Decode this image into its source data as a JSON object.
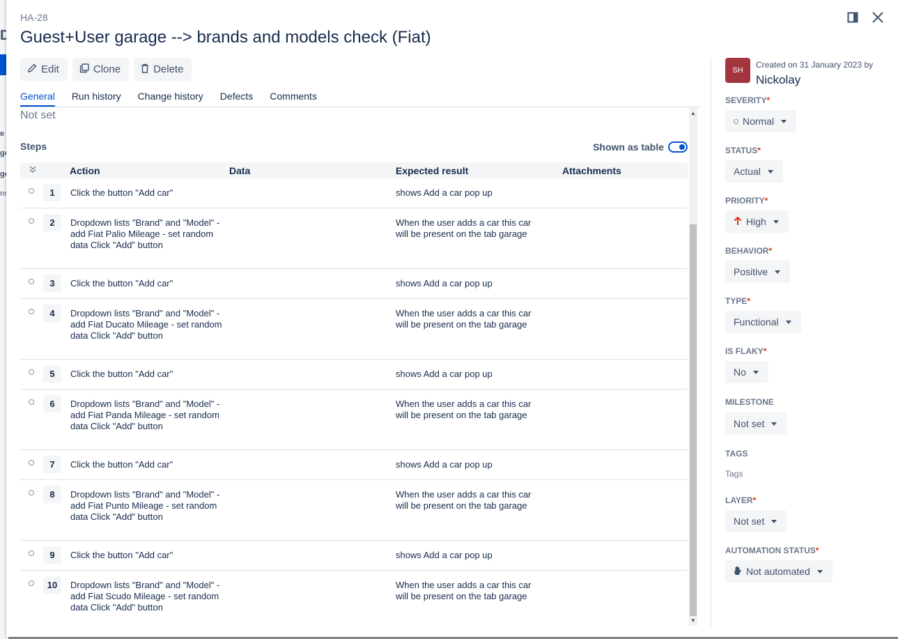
{
  "background": {
    "fragments": [
      "D",
      "e",
      "ge",
      "ge",
      "ns"
    ]
  },
  "issue": {
    "key": "HA-28",
    "title": "Guest+User garage --> brands and models check (Fiat)"
  },
  "toolbar": {
    "edit": "Edit",
    "clone": "Clone",
    "delete": "Delete"
  },
  "tabs": [
    "General",
    "Run history",
    "Change history",
    "Defects",
    "Comments"
  ],
  "general": {
    "precondition_value": "Not set",
    "steps_label": "Steps",
    "shown_as_table_label": "Shown as table",
    "shown_as_table": true,
    "columns": {
      "action": "Action",
      "data": "Data",
      "expected": "Expected result",
      "attachments": "Attachments"
    },
    "steps": [
      {
        "n": "1",
        "action": "Click the button \"Add car\"",
        "data": "",
        "expected": "shows Add a car pop up"
      },
      {
        "n": "2",
        "action": "Dropdown lists \"Brand\" and \"Model\" - add Fiat Palio Mileage - set random data Click \"Add\" button",
        "data": "",
        "expected": "When the user adds a car this car will be present on the tab garage"
      },
      {
        "n": "3",
        "action": "Click the button \"Add car\"",
        "data": "",
        "expected": "shows Add a car pop up"
      },
      {
        "n": "4",
        "action": "Dropdown lists \"Brand\" and \"Model\" - add Fiat Ducato Mileage - set random data Click \"Add\" button",
        "data": "",
        "expected": "When the user adds a car this car will be present on the tab garage"
      },
      {
        "n": "5",
        "action": "Click the button \"Add car\"",
        "data": "",
        "expected": "shows Add a car pop up"
      },
      {
        "n": "6",
        "action": "Dropdown lists \"Brand\" and \"Model\" - add Fiat Panda Mileage - set random data Click \"Add\" button",
        "data": "",
        "expected": "When the user adds a car this car will be present on the tab garage"
      },
      {
        "n": "7",
        "action": "Click the button \"Add car\"",
        "data": "",
        "expected": "shows Add a car pop up"
      },
      {
        "n": "8",
        "action": "Dropdown lists \"Brand\" and \"Model\" - add Fiat Punto Mileage - set random data Click \"Add\" button",
        "data": "",
        "expected": "When the user adds a car this car will be present on the tab garage"
      },
      {
        "n": "9",
        "action": "Click the button \"Add car\"",
        "data": "",
        "expected": "shows Add a car pop up"
      },
      {
        "n": "10",
        "action": "Dropdown lists \"Brand\" and \"Model\" - add Fiat Scudo Mileage - set random data Click \"Add\" button",
        "data": "",
        "expected": "When the user adds a car this car will be present on the tab garage"
      }
    ]
  },
  "sidebar": {
    "avatar_initials": "SH",
    "created_text": "Created on 31 January 2023 by",
    "author": "Nickolay",
    "fields": {
      "severity": {
        "label": "SEVERITY",
        "value": "Normal"
      },
      "status": {
        "label": "STATUS",
        "value": "Actual"
      },
      "priority": {
        "label": "PRIORITY",
        "value": "High"
      },
      "behavior": {
        "label": "BEHAVIOR",
        "value": "Positive"
      },
      "type": {
        "label": "TYPE",
        "value": "Functional"
      },
      "is_flaky": {
        "label": "IS FLAKY",
        "value": "No"
      },
      "milestone": {
        "label": "MILESTONE",
        "value": "Not set"
      },
      "tags": {
        "label": "TAGS",
        "value": "Tags"
      },
      "layer": {
        "label": "LAYER",
        "value": "Not set"
      },
      "automation_status": {
        "label": "AUTOMATION STATUS",
        "value": "Not automated"
      }
    },
    "required_mark": "*"
  },
  "colors": {
    "accent": "#0052cc",
    "priority_high": "#de350b",
    "avatar": "#a3353f"
  }
}
